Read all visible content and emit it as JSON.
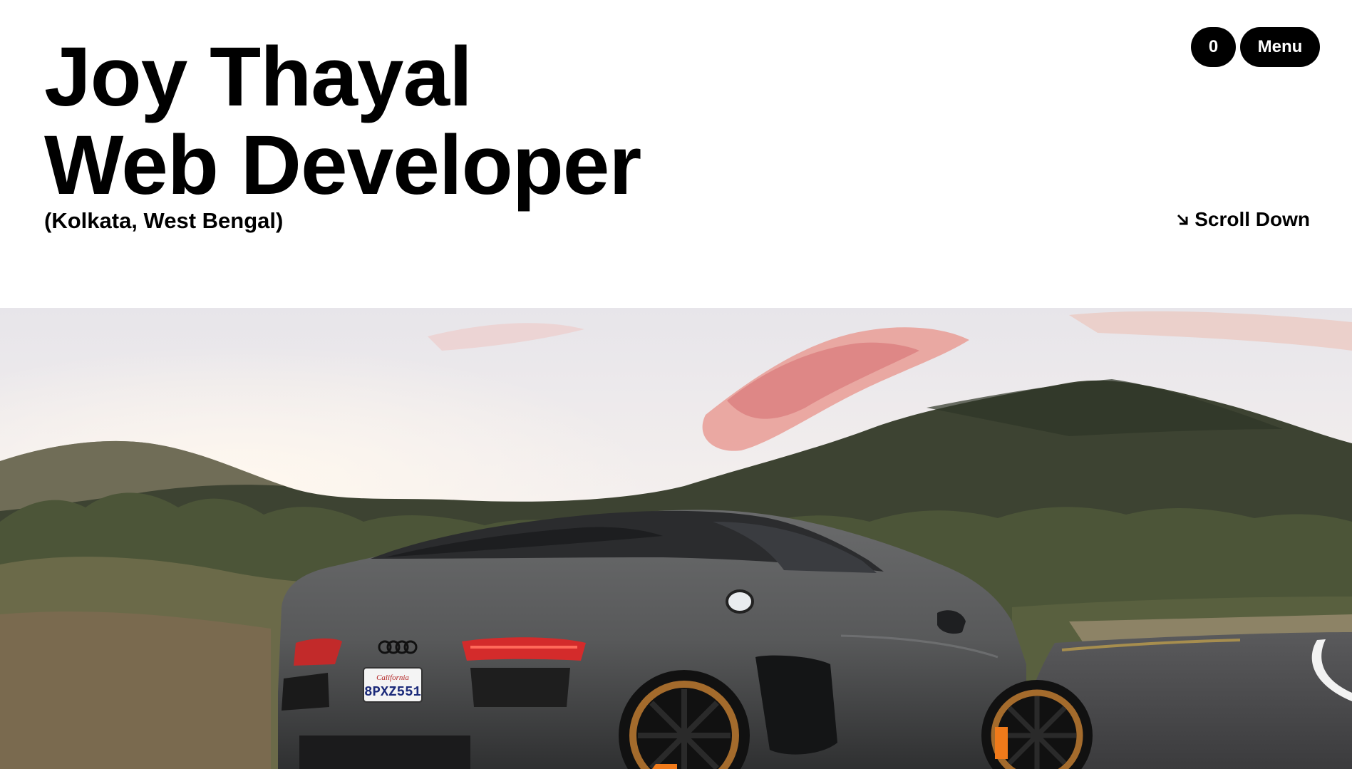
{
  "header": {
    "name": "Joy Thayal",
    "role": "Web Developer",
    "location": "(Kolkata, West Bengal)"
  },
  "nav": {
    "cart_count": "0",
    "menu_label": "Menu"
  },
  "scroll": {
    "label": "Scroll Down",
    "icon": "arrow-down-right-icon"
  },
  "hero_image": {
    "plate_text": "8PXZ551",
    "plate_state": "California"
  },
  "colors": {
    "background": "#ffffff",
    "text": "#000000",
    "pill_bg": "#000000",
    "pill_text": "#ffffff"
  }
}
